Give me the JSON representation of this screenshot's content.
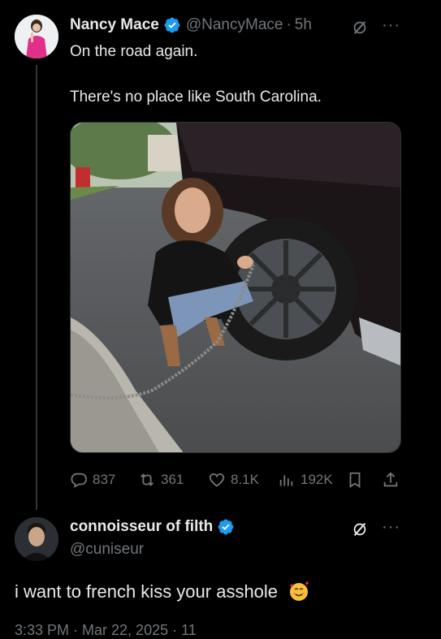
{
  "tweet": {
    "display_name": "Nancy Mace",
    "handle": "@NancyMace",
    "separator": "·",
    "time": "5h",
    "line1": "On the road again.",
    "line2": "There's no place like South Carolina.",
    "actions": {
      "replies": "837",
      "reposts": "361",
      "likes": "8.1K",
      "views": "192K"
    }
  },
  "reply": {
    "display_name": "connoisseur of filth",
    "handle": "@cuniseur",
    "text": "i want to french kiss your asshole",
    "meta_partial": "3:33 PM · Mar 22, 2025 · 11"
  },
  "colors": {
    "background": "#000000",
    "verified": "#1d9bf0",
    "muted": "#71767b",
    "text": "#e7e9ea",
    "thread_line": "#333639"
  },
  "icons": [
    "verified-badge-icon",
    "grok-icon",
    "more-icon",
    "reply-icon",
    "repost-icon",
    "like-icon",
    "views-icon",
    "bookmark-icon",
    "share-icon",
    "smiling-face-with-hearts-emoji"
  ]
}
